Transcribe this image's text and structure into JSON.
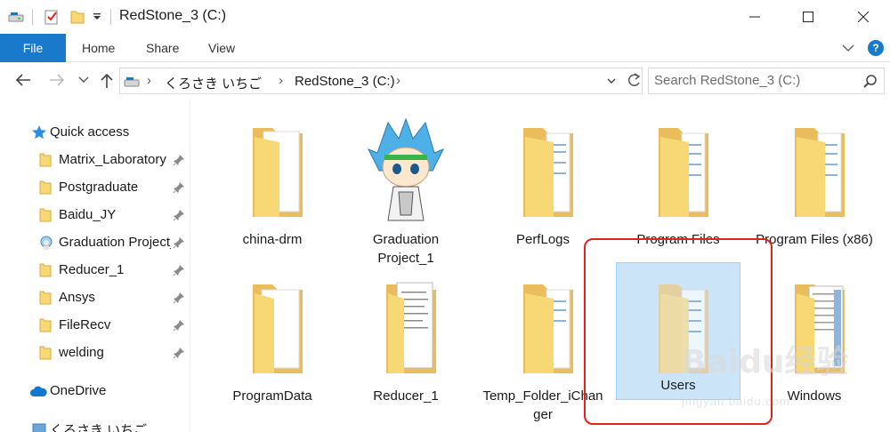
{
  "window": {
    "title": "RedStone_3 (C:)",
    "buttons": {
      "minimize": "—",
      "maximize": "☐",
      "close": "✕"
    }
  },
  "ribbon": {
    "file_tab": "File",
    "tabs": [
      "Home",
      "Share",
      "View"
    ],
    "help": "?"
  },
  "address_bar": {
    "crumbs": [
      "くろさき いちご",
      "RedStone_3 (C:)"
    ]
  },
  "search": {
    "placeholder": "Search RedStone_3 (C:)"
  },
  "nav_pane": {
    "quick_access": "Quick access",
    "pinned": [
      {
        "label": "Matrix_Laboratory",
        "icon": "folder-icon"
      },
      {
        "label": "Postgraduate",
        "icon": "folder-icon"
      },
      {
        "label": "Baidu_JY",
        "icon": "folder-icon"
      },
      {
        "label": "Graduation Project_1",
        "icon": "folder-avatar-icon"
      },
      {
        "label": "Reducer_1",
        "icon": "folder-icon"
      },
      {
        "label": "Ansys",
        "icon": "folder-icon"
      },
      {
        "label": "FileRecv",
        "icon": "folder-icon"
      },
      {
        "label": "welding",
        "icon": "folder-icon"
      }
    ],
    "onedrive": "OneDrive",
    "user": "くろさき いちご"
  },
  "items": [
    {
      "name": "china-drm",
      "kind": "folder-docs"
    },
    {
      "name": "Graduation Project_1",
      "kind": "avatar"
    },
    {
      "name": "PerfLogs",
      "kind": "folder-docs"
    },
    {
      "name": "Program Files",
      "kind": "folder-docs"
    },
    {
      "name": "Program Files (x86)",
      "kind": "folder-docs"
    },
    {
      "name": "ProgramData",
      "kind": "folder-empty"
    },
    {
      "name": "Reducer_1",
      "kind": "folder-papers"
    },
    {
      "name": "Temp_Folder_iChanger",
      "kind": "folder-docs"
    },
    {
      "name": "Users",
      "kind": "folder-docs",
      "selected": true
    },
    {
      "name": "Windows",
      "kind": "folder-docs"
    }
  ],
  "watermark": {
    "text": "Baidu经验",
    "sub": "jingyan.baidu.com"
  },
  "colors": {
    "accent": "#1979ca",
    "selection": "#cce4f7",
    "highlight": "#e0241c",
    "folder": "#f8d775"
  }
}
